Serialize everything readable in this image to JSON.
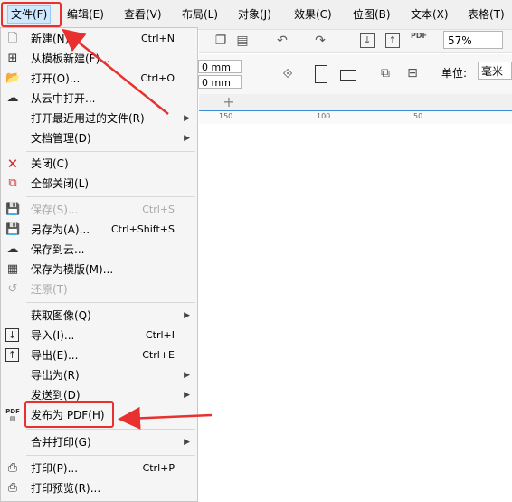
{
  "menubar": {
    "items": [
      "文件(F)",
      "编辑(E)",
      "查看(V)",
      "布局(L)",
      "对象(J)",
      "效果(C)",
      "位图(B)",
      "文本(X)",
      "表格(T)"
    ]
  },
  "toolbar": {
    "zoom": "57%",
    "width_value": "0 mm",
    "height_value": "0 mm",
    "unit_label": "单位:",
    "unit_value": "毫米",
    "pdf_label": "PDF"
  },
  "ruler": {
    "ticks": [
      "150",
      "100",
      "50"
    ]
  },
  "file_menu": {
    "items": [
      {
        "label": "新建(N)",
        "shortcut": "Ctrl+N",
        "icon": "new-document-icon"
      },
      {
        "label": "从模板新建(F)...",
        "shortcut": "",
        "icon": "template-icon"
      },
      {
        "label": "打开(O)...",
        "shortcut": "Ctrl+O",
        "icon": "folder-open-icon"
      },
      {
        "label": "从云中打开...",
        "shortcut": "",
        "icon": "cloud-icon"
      },
      {
        "label": "打开最近用过的文件(R)",
        "shortcut": "",
        "icon": ""
      },
      {
        "label": "文档管理(D)",
        "shortcut": "",
        "icon": ""
      },
      {
        "label": "关闭(C)",
        "shortcut": "",
        "icon": "close-document-icon"
      },
      {
        "label": "全部关闭(L)",
        "shortcut": "",
        "icon": "close-all-icon"
      },
      {
        "label": "保存(S)...",
        "shortcut": "Ctrl+S",
        "icon": "save-icon"
      },
      {
        "label": "另存为(A)...",
        "shortcut": "Ctrl+Shift+S",
        "icon": "save-as-icon"
      },
      {
        "label": "保存到云...",
        "shortcut": "",
        "icon": "cloud-upload-icon"
      },
      {
        "label": "保存为模版(M)...",
        "shortcut": "",
        "icon": "save-template-icon"
      },
      {
        "label": "还原(T)",
        "shortcut": "",
        "icon": "revert-icon"
      },
      {
        "label": "获取图像(Q)",
        "shortcut": "",
        "icon": ""
      },
      {
        "label": "导入(I)...",
        "shortcut": "Ctrl+I",
        "icon": "import-icon"
      },
      {
        "label": "导出(E)...",
        "shortcut": "Ctrl+E",
        "icon": "export-icon"
      },
      {
        "label": "导出为(R)",
        "shortcut": "",
        "icon": ""
      },
      {
        "label": "发送到(D)",
        "shortcut": "",
        "icon": ""
      },
      {
        "label": "发布为 PDF(H)",
        "shortcut": "",
        "icon": "pdf-icon"
      },
      {
        "label": "合并打印(G)",
        "shortcut": "",
        "icon": ""
      },
      {
        "label": "打印(P)...",
        "shortcut": "Ctrl+P",
        "icon": "print-icon"
      },
      {
        "label": "打印预览(R)...",
        "shortcut": "",
        "icon": "print-preview-icon"
      }
    ]
  },
  "colors": {
    "highlight": "#e8312f",
    "accent": "#3c8dd6"
  }
}
